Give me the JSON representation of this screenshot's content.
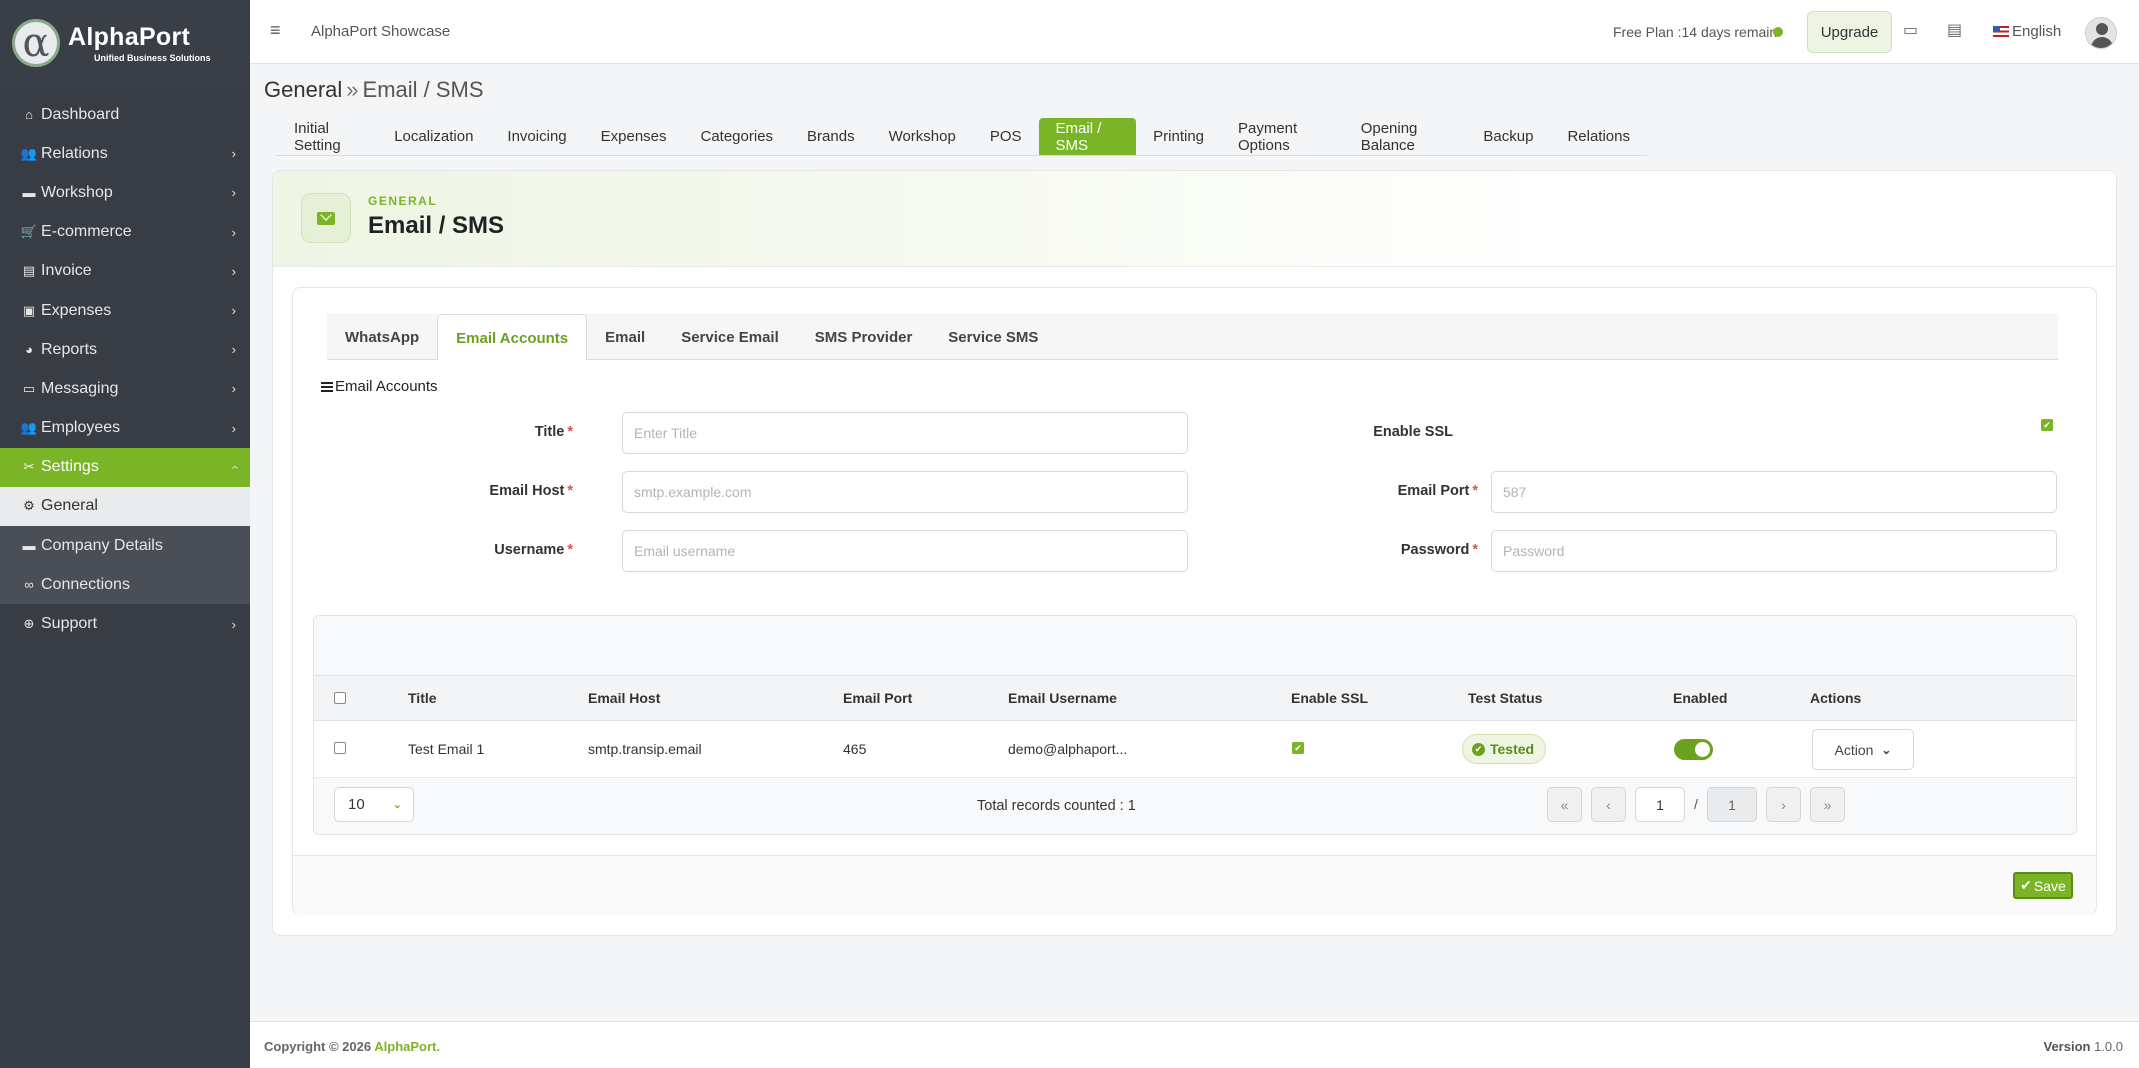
{
  "brand": {
    "title": "AlphaPort",
    "subtitle": "Unified Business Solutions",
    "mark": "α"
  },
  "sidebar": {
    "items": [
      {
        "label": "Dashboard",
        "icon": "home-icon"
      },
      {
        "label": "Relations",
        "icon": "users-icon"
      },
      {
        "label": "Workshop",
        "icon": "briefcase-icon"
      },
      {
        "label": "E-commerce",
        "icon": "cart-icon"
      },
      {
        "label": "Invoice",
        "icon": "file-icon"
      },
      {
        "label": "Expenses",
        "icon": "money-icon"
      },
      {
        "label": "Reports",
        "icon": "pie-chart-icon"
      },
      {
        "label": "Messaging",
        "icon": "message-icon"
      },
      {
        "label": "Employees",
        "icon": "employees-icon"
      },
      {
        "label": "Settings",
        "icon": "tools-icon"
      },
      {
        "label": "General",
        "icon": "gear-icon"
      },
      {
        "label": "Company Details",
        "icon": "briefcase-icon"
      },
      {
        "label": "Connections",
        "icon": "link-icon"
      },
      {
        "label": "Support",
        "icon": "lifebuoy-icon"
      }
    ]
  },
  "topbar": {
    "app_name": "AlphaPort Showcase",
    "plan_text": "Free Plan :14 days remain",
    "upgrade_label": "Upgrade",
    "language": "English"
  },
  "breadcrumb": {
    "root": "General",
    "separator": "»",
    "current": "Email / SMS"
  },
  "settings_tabs": [
    "Initial Setting",
    "Localization",
    "Invoicing",
    "Expenses",
    "Categories",
    "Brands",
    "Workshop",
    "POS",
    "Email / SMS",
    "Printing",
    "Payment Options",
    "Opening Balance",
    "Backup",
    "Relations"
  ],
  "active_settings_tab": "Email / SMS",
  "card": {
    "overline": "GENERAL",
    "title": "Email / SMS"
  },
  "inner_tabs": [
    "WhatsApp",
    "Email Accounts",
    "Email",
    "Service Email",
    "SMS Provider",
    "Service SMS"
  ],
  "active_inner_tab": "Email Accounts",
  "section_title": "Email Accounts",
  "form": {
    "title": {
      "label": "Title",
      "placeholder": "Enter Title",
      "value": ""
    },
    "email_host": {
      "label": "Email Host",
      "placeholder": "smtp.example.com",
      "value": ""
    },
    "username": {
      "label": "Username",
      "placeholder": "Email username",
      "value": ""
    },
    "enable_ssl": {
      "label": "Enable SSL",
      "checked": true
    },
    "email_port": {
      "label": "Email Port",
      "placeholder": "587",
      "value": ""
    },
    "password": {
      "label": "Password",
      "placeholder": "Password",
      "value": ""
    },
    "required_mark": "*"
  },
  "table": {
    "columns": [
      "Title",
      "Email Host",
      "Email Port",
      "Email Username",
      "Enable SSL",
      "Test Status",
      "Enabled",
      "Actions"
    ],
    "rows": [
      {
        "title": "Test Email 1",
        "email_host": "smtp.transip.email",
        "email_port": "465",
        "email_username": "demo@alphaport...",
        "enable_ssl": true,
        "test_status": "Tested",
        "enabled": true,
        "action_label": "Action"
      }
    ],
    "page_size": "10",
    "total_text": "Total records counted : 1",
    "current_page": "1",
    "page_separator": "/",
    "total_pages": "1"
  },
  "save_label": "Save",
  "footer": {
    "copyright": "Copyright © 2026",
    "brand": "AlphaPort.",
    "version_label": "Version",
    "version": "1.0.0"
  },
  "colors": {
    "accent": "#7ab427",
    "sidebar": "#383d45",
    "danger": "#d9534f"
  }
}
